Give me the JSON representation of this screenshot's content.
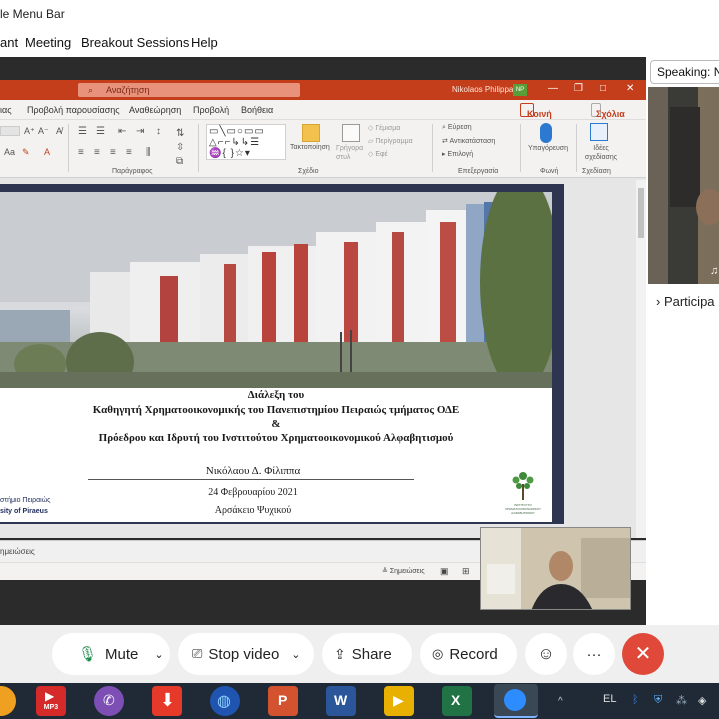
{
  "window": {
    "title_fragment": "le Menu Bar"
  },
  "menu": [
    "ant",
    "Meeting",
    "Breakout Sessions",
    "Help"
  ],
  "ppt": {
    "search_placeholder": "Αναζήτηση",
    "user": "Nikolaos Philippas",
    "avatar": "NP",
    "tabs": [
      "ιας",
      "Προβολή παρουσίασης",
      "Αναθεώρηση",
      "Προβολή",
      "Βοήθεια"
    ],
    "share_button": "Κοινή χρήση",
    "comments_button": "Σχόλια",
    "ribbon": {
      "arrange": "Τακτοποίηση",
      "quick_styles": "Γρήγορα στυλ",
      "fill": "Γέμισμα",
      "outline": "Περίγραμμα",
      "effects": "Εφέ",
      "find": "Εύρεση",
      "replace": "Αντικατάσταση",
      "select": "Επιλογή",
      "dictate": "Υπαγόρευση",
      "designer_ideas": "Ιδέες σχεδίασης",
      "group_paragraph": "Παράγραφος",
      "group_drawing": "Σχέδιο",
      "group_editing": "Επεξεργασία",
      "group_voice": "Φωνή",
      "group_designer": "Σχεδίαση"
    },
    "slide": {
      "line1": "Διάλεξη του",
      "line2": "Καθηγητή Χρηματοοικονομικής του Πανεπιστημίου Πειραιώς τμήματος ΟΔΕ",
      "line3": "&",
      "line4": "Πρόεδρου και Ιδρυτή του Ινστιτούτου Χρηματοοικονομικού Αλφαβητισμού",
      "name": "Νικόλαου Δ. Φίλιππα",
      "date": "24 Φεβρουαρίου 2021",
      "place": "Αρσάκειο Ψυχικού",
      "univ_gr": "στήμιο Πειραιώς",
      "univ_en": "sity of Piraeus",
      "institute_logo_text": "ΙΝΣΤΙΤΟΥΤΟ ΧΡΗΜΑΤΟΟΙΚΟΝΟΜΙΚΟΥ ΑΛΦΑΒΗΤΙΣΜΟΥ"
    },
    "notes_label": "ημειώσεις",
    "status_notes": "Σημειώσεις"
  },
  "panel": {
    "speaking": "Speaking: N",
    "participants": "Participa"
  },
  "toolbar": {
    "mute": "Mute",
    "stop_video": "Stop video",
    "share": "Share",
    "record": "Record",
    "more": "···"
  },
  "taskbar": {
    "lang": "EL",
    "mp3_label": "MP3",
    "ppt_letter": "P",
    "word_letter": "W",
    "excel_letter": "X"
  },
  "colors": {
    "ppt_red": "#c43e1c",
    "leave_red": "#e0483a",
    "slide_frame": "#2e3550"
  }
}
